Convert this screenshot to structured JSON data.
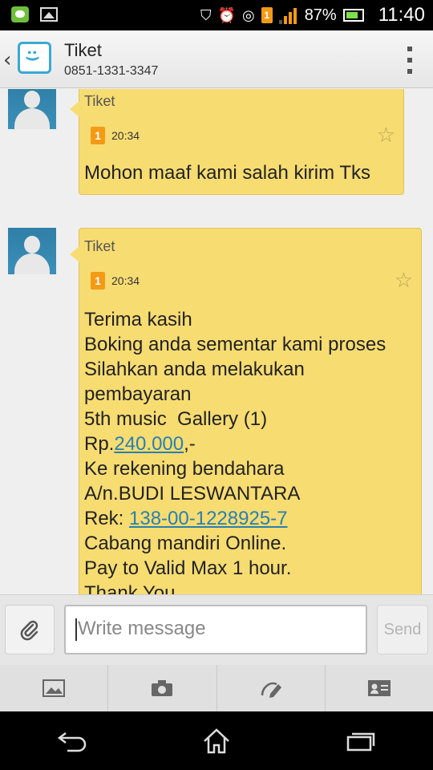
{
  "status_bar": {
    "battery": "87%",
    "time": "11:40",
    "sim_label": "1"
  },
  "header": {
    "title": "Tiket",
    "phone": "0851-1331-3347"
  },
  "messages": [
    {
      "sender": "Tiket",
      "sim": "1",
      "time": "20:34",
      "text": "Mohon maaf kami salah kirim Tks"
    },
    {
      "sender": "Tiket",
      "sim": "1",
      "time": "20:34",
      "lines": {
        "l1": "Terima kasih",
        "l2": "Boking anda sementar kami proses",
        "l3": "Silahkan anda melakukan",
        "l4": "pembayaran",
        "l5": "5th music  Gallery (1)",
        "l6_prefix": "Rp.",
        "l6_amount": "240.000",
        "l6_suffix": ",-",
        "l7": "Ke rekening bendahara",
        "l8": "A/n.BUDI LESWANTARA",
        "l9_prefix": "Rek: ",
        "l9_account": "138-00-1228925-7",
        "l10": "Cabang mandiri Online.",
        "l11": "Pay to Valid Max 1 hour.",
        "l12": "Thank You"
      }
    }
  ],
  "compose": {
    "placeholder": "Write message",
    "send_label": "Send"
  },
  "toolbar": {
    "items": [
      "picture-icon",
      "camera-icon",
      "edit-icon",
      "contact-card-icon"
    ]
  },
  "nav": {
    "items": [
      "back-icon",
      "home-icon",
      "recents-icon"
    ]
  }
}
